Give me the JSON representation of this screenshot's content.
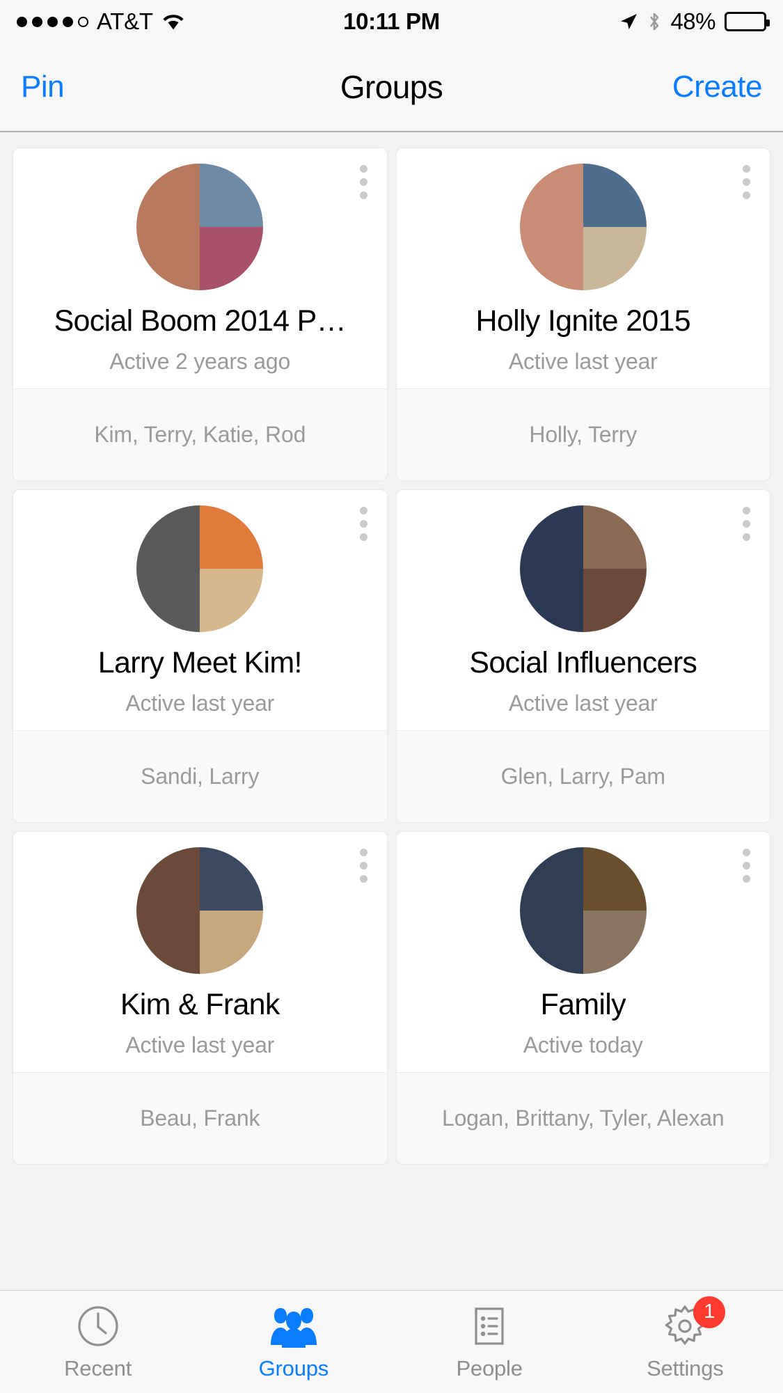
{
  "status_bar": {
    "signal_dots_filled": 4,
    "signal_dots_total": 5,
    "carrier": "AT&T",
    "wifi_icon": "wifi-icon",
    "time": "10:11 PM",
    "location_icon": "location-arrow-icon",
    "bluetooth_icon": "bluetooth-icon",
    "battery_percent": "48%",
    "battery_level": 48
  },
  "nav_bar": {
    "left_button": "Pin",
    "title": "Groups",
    "right_button": "Create",
    "accent_color": "#0a7cff"
  },
  "groups": [
    {
      "title": "Social Boom 2014 P…",
      "activity": "Active 2 years ago",
      "members": "Kim, Terry, Katie, Rod",
      "menu_icon": "kebab-menu-icon",
      "avatar": {
        "left": "#b87a5e",
        "right_top": "#6d8aa6",
        "right_bottom": "#a8506a"
      }
    },
    {
      "title": "Holly Ignite 2015",
      "activity": "Active last year",
      "members": "Holly, Terry",
      "menu_icon": "kebab-menu-icon",
      "avatar": {
        "left": "#c98c74",
        "right_top": "#4f6d8c",
        "right_bottom": "#c9b79a"
      }
    },
    {
      "title": "Larry Meet Kim!",
      "activity": "Active last year",
      "members": "Sandi, Larry",
      "menu_icon": "kebab-menu-icon",
      "avatar": {
        "left": "#5a5a5a",
        "right_top": "#e07b3c",
        "right_bottom": "#d7b98f"
      }
    },
    {
      "title": "Social Influencers",
      "activity": "Active last year",
      "members": "Glen, Larry, Pam",
      "menu_icon": "kebab-menu-icon",
      "avatar": {
        "left": "#2b3a52",
        "right_top": "#8a6a52",
        "right_bottom": "#6b4a3a"
      }
    },
    {
      "title": "Kim & Frank",
      "activity": "Active last year",
      "members": "Beau, Frank",
      "menu_icon": "kebab-menu-icon",
      "avatar": {
        "left": "#6b4a3a",
        "right_top": "#3b4a60",
        "right_bottom": "#c7a77e"
      }
    },
    {
      "title": "Family",
      "activity": "Active today",
      "members": "Logan, Brittany, Tyler, Alexan",
      "menu_icon": "kebab-menu-icon",
      "avatar": {
        "left": "#2f3d55",
        "right_top": "#6a4f2e",
        "right_bottom": "#8a7560"
      }
    }
  ],
  "tab_bar": {
    "tabs": [
      {
        "label": "Recent",
        "icon": "clock-icon",
        "active": false,
        "badge": null
      },
      {
        "label": "Groups",
        "icon": "people-icon",
        "active": true,
        "badge": null
      },
      {
        "label": "People",
        "icon": "list-icon",
        "active": false,
        "badge": null
      },
      {
        "label": "Settings",
        "icon": "gear-icon",
        "active": false,
        "badge": "1"
      }
    ],
    "active_color": "#0a7cff",
    "inactive_color": "#8e8e93",
    "badge_color": "#ff3b30"
  }
}
